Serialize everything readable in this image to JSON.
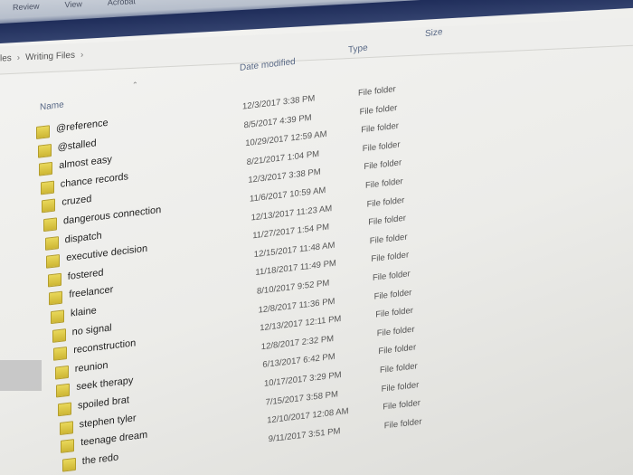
{
  "ribbon": {
    "tabs": [
      "Review",
      "View",
      "Acrobat"
    ]
  },
  "address": {
    "crumbs": [
      "les",
      "Writing Files"
    ]
  },
  "columns": {
    "name": "Name",
    "date": "Date modified",
    "type": "Type",
    "size": "Size"
  },
  "colors": {
    "folder": "#d9c440",
    "ribbon_dark": "#1f2d5a",
    "header_text": "#5a6a87"
  },
  "files": [
    {
      "name": "@reference",
      "date": "12/3/2017 3:38 PM",
      "type": "File folder"
    },
    {
      "name": "@stalled",
      "date": "8/5/2017 4:39 PM",
      "type": "File folder"
    },
    {
      "name": "almost easy",
      "date": "10/29/2017 12:59 AM",
      "type": "File folder"
    },
    {
      "name": "chance records",
      "date": "8/21/2017 1:04 PM",
      "type": "File folder"
    },
    {
      "name": "cruzed",
      "date": "12/3/2017 3:38 PM",
      "type": "File folder"
    },
    {
      "name": "dangerous connection",
      "date": "11/6/2017 10:59 AM",
      "type": "File folder"
    },
    {
      "name": "dispatch",
      "date": "12/13/2017 11:23 AM",
      "type": "File folder"
    },
    {
      "name": "executive decision",
      "date": "11/27/2017 1:54 PM",
      "type": "File folder"
    },
    {
      "name": "fostered",
      "date": "12/15/2017 11:48 AM",
      "type": "File folder"
    },
    {
      "name": "freelancer",
      "date": "11/18/2017 11:49 PM",
      "type": "File folder"
    },
    {
      "name": "klaine",
      "date": "8/10/2017 9:52 PM",
      "type": "File folder"
    },
    {
      "name": "no signal",
      "date": "12/8/2017 11:36 PM",
      "type": "File folder"
    },
    {
      "name": "reconstruction",
      "date": "12/13/2017 12:11 PM",
      "type": "File folder"
    },
    {
      "name": "reunion",
      "date": "12/8/2017 2:32 PM",
      "type": "File folder"
    },
    {
      "name": "seek therapy",
      "date": "6/13/2017 6:42 PM",
      "type": "File folder"
    },
    {
      "name": "spoiled brat",
      "date": "10/17/2017 3:29 PM",
      "type": "File folder"
    },
    {
      "name": "stephen tyler",
      "date": "7/15/2017 3:58 PM",
      "type": "File folder"
    },
    {
      "name": "teenage dream",
      "date": "12/10/2017 12:08 AM",
      "type": "File folder"
    },
    {
      "name": "the redo",
      "date": "9/11/2017 3:51 PM",
      "type": "File folder"
    }
  ]
}
